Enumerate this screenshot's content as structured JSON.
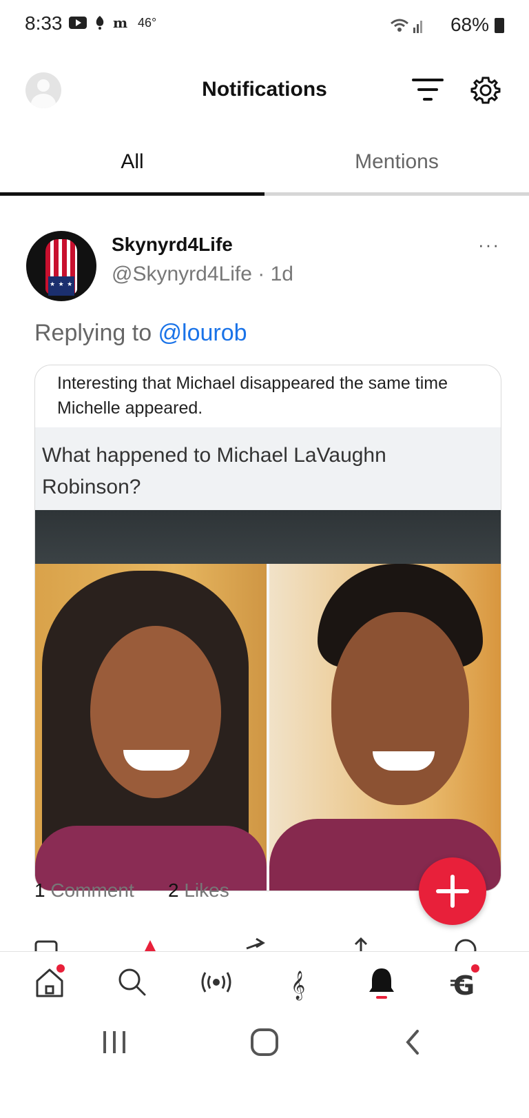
{
  "status_bar": {
    "time": "8:33",
    "temperature": "46°",
    "battery": "68%",
    "icons": [
      "youtube-icon",
      "notification-icon",
      "news-icon",
      "wifi-icon",
      "signal-icon",
      "battery-icon"
    ]
  },
  "header": {
    "title": "Notifications",
    "icons": [
      "profile-avatar",
      "filter-icon",
      "settings-gear-icon"
    ]
  },
  "tabs": [
    {
      "label": "All",
      "active": true
    },
    {
      "label": "Mentions",
      "active": false
    }
  ],
  "post": {
    "user_name": "Skynyrd4Life",
    "handle": "@Skynyrd4Life",
    "separator": " · ",
    "age": "1d",
    "more": "···",
    "replying_prefix": "Replying to ",
    "replying_to": "@lourob",
    "text": "Interesting that Michael disappeared the same time Michelle appeared.",
    "image_caption": "What happened to Michael LaVaughn Robinson?",
    "comment_count": "1",
    "comment_label": "Comment",
    "like_count": "2",
    "like_label": "Likes"
  },
  "colors": {
    "accent": "#e8203a",
    "link": "#1a73e8"
  },
  "bottom_nav": [
    "home-icon",
    "search-icon",
    "live-broadcast-icon",
    "music-icon",
    "notifications-bell-icon",
    "currency-icon"
  ],
  "system_nav": [
    "recent-apps-icon",
    "home-circle-icon",
    "back-icon"
  ]
}
